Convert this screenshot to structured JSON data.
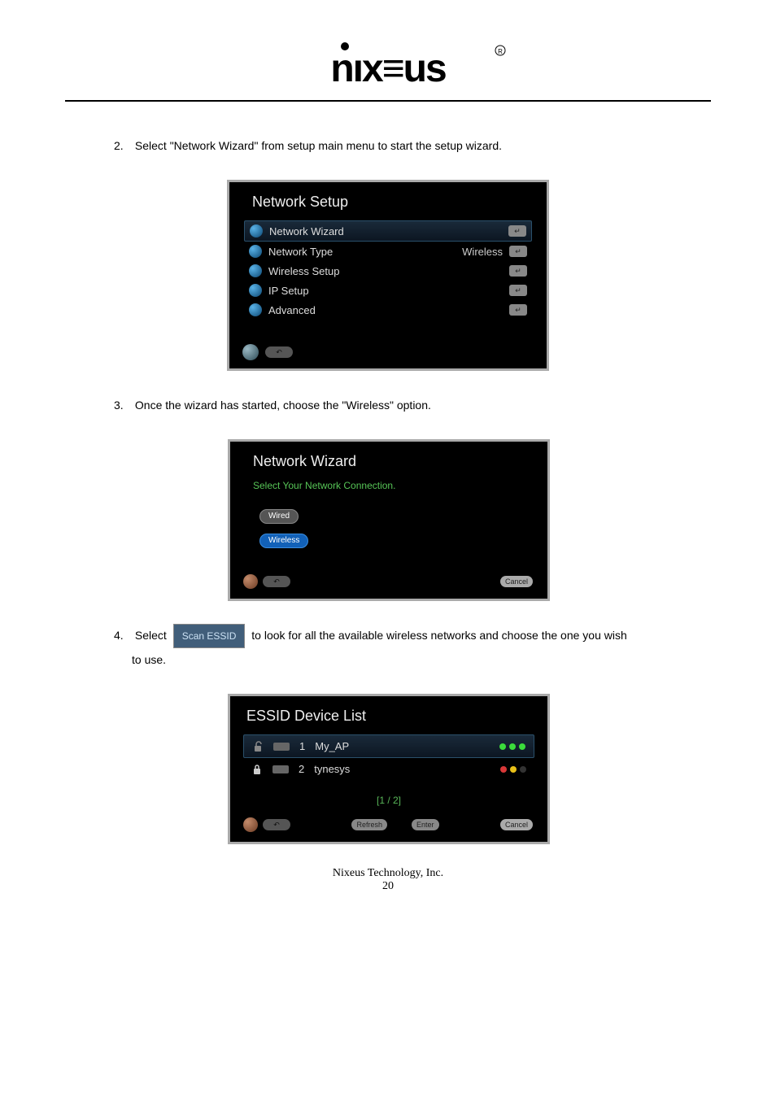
{
  "logo": {
    "alt": "nixeus"
  },
  "steps": {
    "s2": {
      "num": "2.",
      "text": "Select \"Network Wizard\" from setup main menu to start the setup wizard."
    },
    "s3": {
      "num": "3.",
      "text": "Once the wizard has started, choose the \"Wireless\" option."
    },
    "s4": {
      "num": "4.",
      "prefix": "Select ",
      "btn": "Scan ESSID",
      "suffix": " to look for all the available wireless networks and choose the one you wish",
      "line2": "to use."
    }
  },
  "shot1": {
    "title": "Network Setup",
    "items": [
      {
        "label": "Network Wizard",
        "value": ""
      },
      {
        "label": "Network Type",
        "value": "Wireless"
      },
      {
        "label": "Wireless Setup",
        "value": ""
      },
      {
        "label": "IP Setup",
        "value": ""
      },
      {
        "label": "Advanced",
        "value": ""
      }
    ]
  },
  "shot2": {
    "title": "Network Wizard",
    "subtitle": "Select Your Network Connection.",
    "wired": "Wired",
    "wireless": "Wireless",
    "cancel": "Cancel"
  },
  "shot3": {
    "title": "ESSID Device List",
    "rows": [
      {
        "idx": "1",
        "name": "My_AP"
      },
      {
        "idx": "2",
        "name": "tynesys"
      }
    ],
    "page": "[1 / 2]",
    "refresh": "Refresh",
    "enter": "Enter",
    "cancel2": "Cancel"
  },
  "footer": {
    "company": "Nixeus Technology, Inc.",
    "page": "20"
  }
}
